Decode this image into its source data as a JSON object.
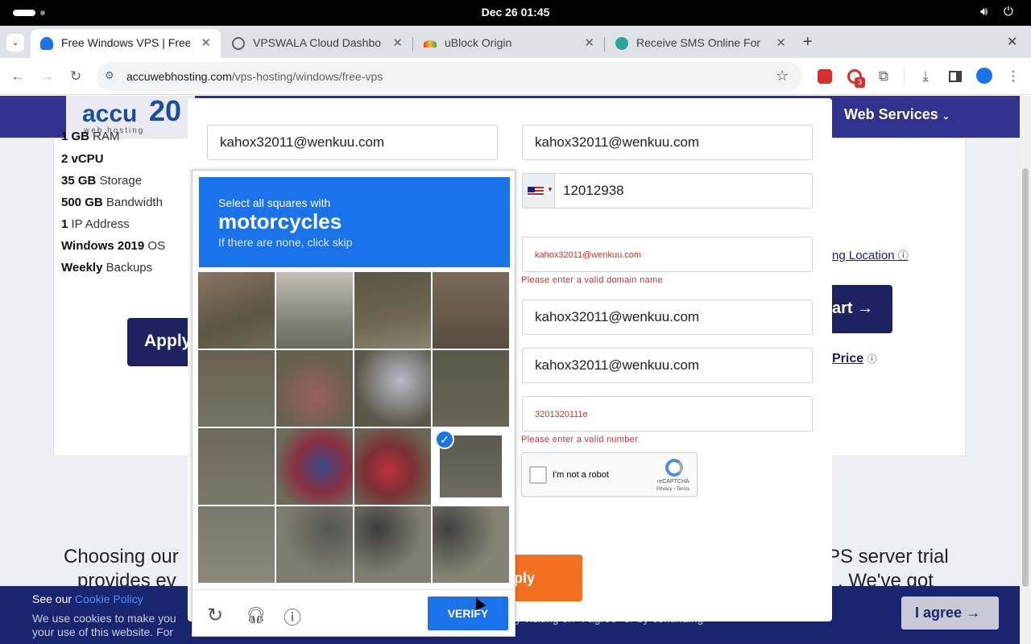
{
  "system": {
    "clock": "Dec 26  01:45"
  },
  "tabs": [
    {
      "label": "Free Windows VPS | Free",
      "active": true
    },
    {
      "label": "VPSWALA Cloud Dashbo",
      "active": false
    },
    {
      "label": "uBlock Origin",
      "active": false
    },
    {
      "label": "Receive SMS Online For",
      "active": false
    }
  ],
  "toolbar": {
    "url_host": "accuwebhosting.com",
    "url_path": "/vps-hosting/windows/free-vps",
    "ext_badge": "3"
  },
  "site": {
    "nav_services": "Web Services",
    "logo_text": "accu",
    "logo_sub": "web hosting",
    "specs": [
      {
        "bold": "1 GB",
        "rest": " RAM"
      },
      {
        "bold": "2 vCPU",
        "rest": ""
      },
      {
        "bold": "35 GB",
        "rest": " Storage"
      },
      {
        "bold": "500 GB",
        "rest": " Bandwidth"
      },
      {
        "bold": "1",
        "rest": " IP Address"
      },
      {
        "bold": "Windows 2019",
        "rest": " OS"
      },
      {
        "bold": "Weekly",
        "rest": " Backups"
      }
    ],
    "apply_btn": "Apply",
    "location_link": "ng Location",
    "cart_btn": "art",
    "price_link": "Price",
    "choosing_left": "Choosing our",
    "choosing_right": "PS server trial",
    "provides_left": "provides ev",
    "provides_right": ". We've got"
  },
  "form": {
    "field1": "kahox32011@wenkuu.com",
    "field2": "kahox32011@wenkuu.com",
    "phone": "12012938",
    "domain": "kahox32011@wenkuu.com",
    "domain_error": "Please enter a valid domain name",
    "field5": "kahox32011@wenkuu.com",
    "field6": "kahox32011@wenkuu.com",
    "number": "3201320111e",
    "number_error": "Please enter a valid number.",
    "robot_label": "I'm not a robot",
    "recaptcha_brand": "reCAPTCHA",
    "recaptcha_terms": "Privacy - Terms",
    "apply_btn": "ply"
  },
  "captcha": {
    "instruction": "Select all squares with",
    "target": "motorcycles",
    "hint": "If there are none, click skip",
    "verify_label": "VERIFY",
    "selected_cells": [
      8
    ],
    "accent": "#1a73e8"
  },
  "cookie": {
    "see_our": "See our",
    "policy_link": "Cookie Policy",
    "line1": "We use cookies to make you",
    "line1_tail": "y visiting on \"I agree\" or by continuing",
    "line2": "your use of this website. For",
    "agree_btn": "I agree"
  }
}
